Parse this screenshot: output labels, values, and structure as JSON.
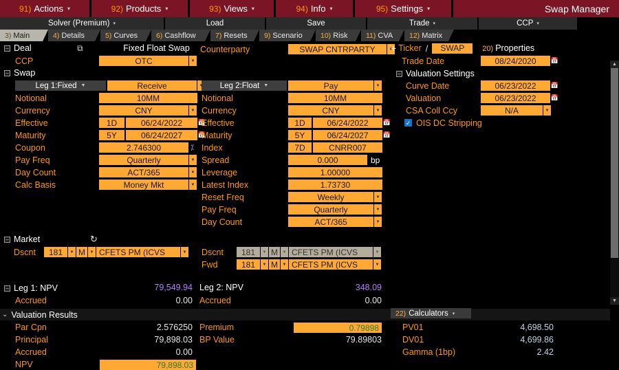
{
  "window": {
    "title": "Swap Manager"
  },
  "menubar": [
    {
      "num": "91)",
      "label": "Actions",
      "caret": "▾"
    },
    {
      "num": "92)",
      "label": "Products",
      "caret": "▾"
    },
    {
      "num": "93)",
      "label": "Views",
      "caret": "▾"
    },
    {
      "num": "94)",
      "label": "Info",
      "caret": "▾"
    },
    {
      "num": "95)",
      "label": "Settings",
      "caret": "▾"
    }
  ],
  "toolbar2": [
    {
      "label": "Solver (Premium)",
      "caret": "▾"
    },
    {
      "label": "Load",
      "caret": ""
    },
    {
      "label": "Save",
      "caret": ""
    },
    {
      "label": "Trade",
      "caret": "▾"
    },
    {
      "label": "CCP",
      "caret": "▾"
    }
  ],
  "tabs": [
    {
      "num": "3)",
      "label": "Main",
      "active": true
    },
    {
      "num": "4)",
      "label": "Details",
      "active": false
    },
    {
      "num": "5)",
      "label": "Curves",
      "active": false
    },
    {
      "num": "6)",
      "label": "Cashflow",
      "active": false
    },
    {
      "num": "7)",
      "label": "Resets",
      "active": false
    },
    {
      "num": "9)",
      "label": "Scenario",
      "active": false
    },
    {
      "num": "10)",
      "label": "Risk",
      "active": false
    },
    {
      "num": "11)",
      "label": "CVA",
      "active": false
    },
    {
      "num": "12)",
      "label": "Matrix",
      "active": false
    }
  ],
  "deal": {
    "section_label": "Deal",
    "product_name": "Fixed Float Swap",
    "copy_icon": "copy-icon",
    "ccp_label": "CCP",
    "ccp_value": "OTC",
    "counterparty_label": "Counterparty",
    "counterparty_value": "SWAP CNTRPARTY"
  },
  "swap": {
    "section_label": "Swap"
  },
  "leg1": {
    "header": "Leg 1:Fixed",
    "direction": "Receive",
    "rows": [
      {
        "label": "Notional",
        "value": "10MM",
        "type": "plain"
      },
      {
        "label": "Currency",
        "value": "CNY",
        "type": "dropdown"
      },
      {
        "label": "Effective",
        "tenor": "1D",
        "value": "06/24/2022",
        "type": "date"
      },
      {
        "label": "Maturity",
        "tenor": "5Y",
        "value": "06/24/2027",
        "type": "date"
      },
      {
        "label": "Coupon",
        "value": "2.746300",
        "type": "pct"
      },
      {
        "label": "Pay Freq",
        "value": "Quarterly",
        "type": "dropdown"
      },
      {
        "label": "Day Count",
        "value": "ACT/365",
        "type": "dropdown"
      },
      {
        "label": "Calc Basis",
        "value": "Money Mkt",
        "type": "dropdown"
      }
    ]
  },
  "leg2": {
    "header": "Leg 2:Float",
    "direction": "Pay",
    "rows": [
      {
        "label": "Notional",
        "value": "10MM",
        "type": "plain"
      },
      {
        "label": "Currency",
        "value": "CNY",
        "type": "dropdown"
      },
      {
        "label": "Effective",
        "tenor": "1D",
        "value": "06/24/2022",
        "type": "date"
      },
      {
        "label": "Maturity",
        "tenor": "5Y",
        "value": "06/24/2027",
        "type": "date"
      },
      {
        "label": "Index",
        "tenor": "7D",
        "value": "CNRR007",
        "type": "index"
      },
      {
        "label": "Spread",
        "value": "0.000",
        "type": "bp",
        "unit": "bp"
      },
      {
        "label": "Leverage",
        "value": "1.00000",
        "type": "plain"
      },
      {
        "label": "Latest Index",
        "value": "1.73730",
        "type": "plain"
      },
      {
        "label": "Reset Freq",
        "value": "Weekly",
        "type": "dropdown"
      },
      {
        "label": "Pay Freq",
        "value": "Quarterly",
        "type": "dropdown"
      },
      {
        "label": "Day Count",
        "value": "ACT/365",
        "type": "dropdown"
      }
    ]
  },
  "ticker": {
    "label": "Ticker",
    "separator": "/",
    "chip": "SWAP",
    "properties_num": "20)",
    "properties_label": "Properties",
    "trade_date_label": "Trade Date",
    "trade_date_value": "08/24/2020"
  },
  "valuation_settings": {
    "section_label": "Valuation Settings",
    "rows": [
      {
        "label": "Curve Date",
        "value": "06/23/2022",
        "type": "date"
      },
      {
        "label": "Valuation",
        "value": "06/23/2022",
        "type": "date"
      },
      {
        "label": "CSA Coll Ccy",
        "value": "N/A",
        "type": "dropdown"
      }
    ],
    "ois_label": "OIS DC Stripping",
    "ois_checked": true
  },
  "market": {
    "section_label": "Market",
    "refresh_icon": "refresh-icon",
    "left": {
      "rows": [
        {
          "label": "Dscnt",
          "num": "181",
          "unit": "M",
          "curve": "CFETS PM     (ICVS",
          "disabled": false
        }
      ]
    },
    "right": {
      "rows": [
        {
          "label": "Dscnt",
          "num": "181",
          "unit": "M",
          "curve": "CFETS PM     (ICVS",
          "disabled": true
        },
        {
          "label": "Fwd",
          "num": "181",
          "unit": "M",
          "curve": "CFETS PM     (ICVS",
          "disabled": false
        }
      ]
    }
  },
  "npv": {
    "leg1_label": "Leg 1: NPV",
    "leg1_value": "79,549.94",
    "leg1_accrued_label": "Accrued",
    "leg1_accrued_value": "0.00",
    "leg2_label": "Leg 2: NPV",
    "leg2_value": "348.09",
    "leg2_accrued_label": "Accrued",
    "leg2_accrued_value": "0.00"
  },
  "valuation_results": {
    "band_label": "Valuation Results",
    "left": [
      {
        "label": "Par Cpn",
        "value": "2.576250",
        "style": "white"
      },
      {
        "label": "Principal",
        "value": "79,898.03",
        "style": "white"
      },
      {
        "label": "Accrued",
        "value": "0.00",
        "style": "white"
      },
      {
        "label": "NPV",
        "value": "79,898.03",
        "style": "green-field"
      }
    ],
    "right": [
      {
        "label": "Premium",
        "value": "0.79898",
        "style": "green-field"
      },
      {
        "label": "BP Value",
        "value": "79.89803",
        "style": "white"
      }
    ]
  },
  "calculators": {
    "num": "22)",
    "label": "Calculators",
    "caret": "▾",
    "rows": [
      {
        "label": "PV01",
        "value": "4,698.50"
      },
      {
        "label": "DV01",
        "value": "4,699.86"
      },
      {
        "label": "Gamma (1bp)",
        "value": "2.42"
      }
    ]
  },
  "colors": {
    "accent_orange": "#ff9900",
    "field_orange": "#ffa834",
    "menu_maroon": "#7b1424",
    "npv_purple": "#b47cff",
    "result_green": "#3ddc55",
    "checkbox_blue": "#1874d2"
  },
  "scrollbar": {
    "up": "▲",
    "down": "▼"
  }
}
